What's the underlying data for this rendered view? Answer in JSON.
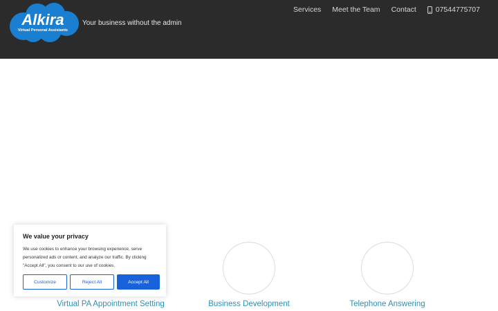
{
  "brand": {
    "logo_name": "Alkira",
    "logo_subtitle": "Virtual Personal Assistants",
    "tagline": "Your business without the admin",
    "logo_blue": "#1a7fd0",
    "header_bg": "#2b2b2b"
  },
  "nav": {
    "items": [
      "Services",
      "Meet the Team",
      "Contact"
    ],
    "phone": "07544775707",
    "phone_icon": "mobile-phone-icon"
  },
  "services": [
    {
      "label": "Virtual PA Appointment Setting"
    },
    {
      "label": "Business Development"
    },
    {
      "label": "Telephone Answering"
    }
  ],
  "cookie": {
    "title": "We value your privacy",
    "text": "We use cookies to enhance your browsing experience, serve personalized ads or content, and analyze our traffic. By clicking \"Accept All\", you consent to our use of cookies.",
    "customize": "Customize",
    "reject": "Reject All",
    "accept": "Accept All",
    "accent": "#1863dc"
  }
}
